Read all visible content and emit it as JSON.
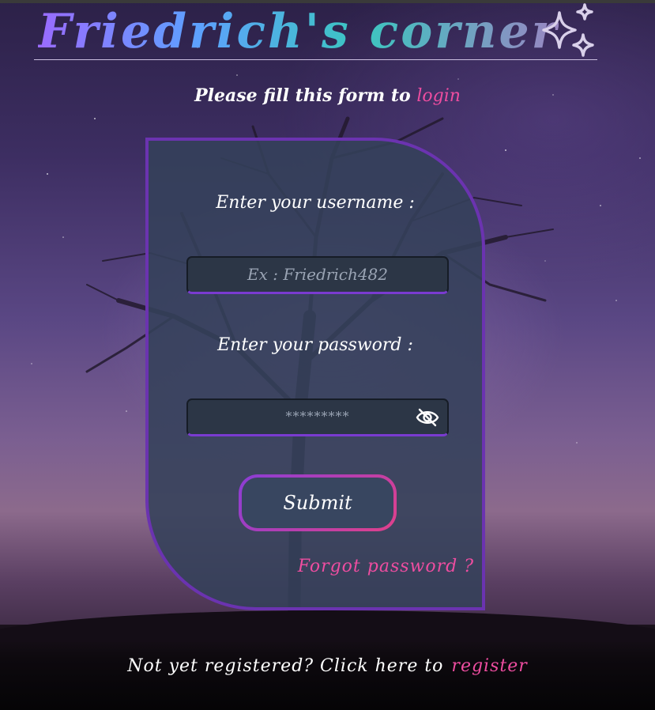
{
  "header": {
    "title": "Friedrich's corner",
    "icon": "sparkles-icon"
  },
  "subtitle": {
    "text": "Please fill this form to",
    "link": "login"
  },
  "form": {
    "username_label": "Enter your username :",
    "username_placeholder": "Ex : Friedrich482",
    "password_label": "Enter your password :",
    "password_value": "*********",
    "password_toggle_icon": "eye-slash-icon",
    "submit_label": "Submit",
    "forgot_label": "Forgot password ?"
  },
  "footer": {
    "text": "Not yet registered? Click here to",
    "link": "register"
  },
  "colors": {
    "accent_pink": "#ee4da0",
    "card_border": "#6b33b0",
    "card_bg": "#34415a"
  }
}
